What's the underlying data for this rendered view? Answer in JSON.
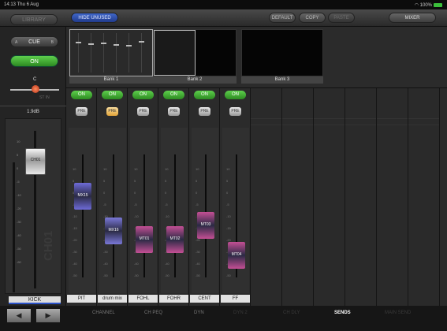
{
  "status_bar": {
    "time": "14:13",
    "date": "Thu 6 Aug",
    "battery": "100%"
  },
  "top_bar": {
    "library": "LIBRARY",
    "hide_unused": "HIDE UNUSED",
    "default": "DEFAULT",
    "copy": "COPY",
    "paste": "PASTE",
    "mixer": "MIXER"
  },
  "left_panel": {
    "cue_a": "A",
    "cue": "CUE",
    "cue_b": "B",
    "on": "ON",
    "pan_label": "C",
    "pan_side": "ST IN",
    "fader_level": "1.9dB",
    "fader_cap": "CH01",
    "vertical_name": "CH01",
    "channel_name": "KICK",
    "scale": [
      "10",
      "5",
      "0",
      "-5",
      "-10",
      "-20",
      "-30",
      "-40",
      "-50",
      "-60"
    ]
  },
  "banks": [
    {
      "label": "Bank 1"
    },
    {
      "label": "Bank 2"
    },
    {
      "label": "Bank 3"
    }
  ],
  "strips": [
    {
      "on": "ON",
      "pre": "PRE",
      "pre_active": false,
      "cap": "MX15",
      "name": "PIT",
      "color": "#6e6bd8",
      "level": 0.66
    },
    {
      "on": "ON",
      "pre": "PRE",
      "pre_active": true,
      "cap": "MX16",
      "name": "drum mix",
      "color": "#7a78d8",
      "level": 0.38
    },
    {
      "on": "ON",
      "pre": "PRE",
      "pre_active": false,
      "cap": "MT01",
      "name": "FOHL",
      "color": "#c44f95",
      "level": 0.31
    },
    {
      "on": "ON",
      "pre": "PRE",
      "pre_active": false,
      "cap": "MT02",
      "name": "FOHR",
      "color": "#c44f95",
      "level": 0.31
    },
    {
      "on": "ON",
      "pre": "PRE",
      "pre_active": false,
      "cap": "MT03",
      "name": "CENT",
      "color": "#c44f95",
      "level": 0.42
    },
    {
      "on": "ON",
      "pre": "PRE",
      "pre_active": false,
      "cap": "MT04",
      "name": "FF",
      "color": "#c44f95",
      "level": 0.18
    }
  ],
  "strip_scale": [
    "10",
    "5",
    "0",
    "-5",
    "-10",
    "-15",
    "-20",
    "-30",
    "-40",
    "-50"
  ],
  "bottom_nav": {
    "left": "◀",
    "right": "▶"
  },
  "tabs": [
    {
      "label": "CHANNEL",
      "state": "normal"
    },
    {
      "label": "CH PEQ",
      "state": "normal"
    },
    {
      "label": "DYN",
      "state": "normal"
    },
    {
      "label": "DYN 2",
      "state": "dim"
    },
    {
      "label": "CH DLY",
      "state": "dim"
    },
    {
      "label": "SENDS",
      "state": "active"
    },
    {
      "label": "MAIN SEND",
      "state": "dim"
    }
  ]
}
